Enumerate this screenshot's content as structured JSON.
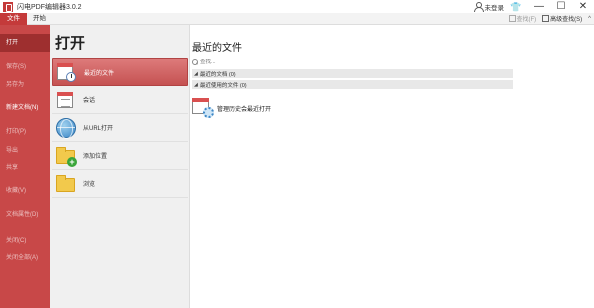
{
  "app": {
    "title": "闪电PDF编辑器3.0.2"
  },
  "titlebar": {
    "login_label": "未登录",
    "icons": [
      "user-icon",
      "shirt-icon",
      "minimize-icon",
      "maximize-icon",
      "close-icon"
    ]
  },
  "ribbon": {
    "tabs": [
      {
        "label": "文件",
        "active": true
      },
      {
        "label": "开始",
        "active": false
      }
    ],
    "find_label": "查找(F)",
    "advanced_find_label": "高级查找(S)",
    "collapse_glyph": "^"
  },
  "nav": {
    "items": [
      {
        "label": "打开",
        "state": "active"
      },
      {
        "label": "保存(S)",
        "state": "disabled"
      },
      {
        "label": "另存为",
        "state": "disabled"
      },
      {
        "label": "新建文档(N)",
        "state": "enabled"
      },
      {
        "label": "打印(P)",
        "state": "disabled"
      },
      {
        "label": "导出",
        "state": "disabled"
      },
      {
        "label": "共享",
        "state": "disabled"
      },
      {
        "label": "收藏(V)",
        "state": "disabled"
      },
      {
        "label": "文档属性(D)",
        "state": "disabled"
      },
      {
        "label": "关闭(C)",
        "state": "disabled"
      },
      {
        "label": "关闭全部(A)",
        "state": "disabled"
      }
    ]
  },
  "open": {
    "heading": "打开",
    "items": [
      {
        "label": "最近的文件",
        "icon": "recent-files-icon",
        "active": true
      },
      {
        "label": "会话",
        "icon": "session-icon",
        "active": false
      },
      {
        "label": "从URL打开",
        "icon": "globe-icon",
        "active": false
      },
      {
        "label": "添加位置",
        "icon": "add-folder-icon",
        "active": false
      },
      {
        "label": "浏览",
        "icon": "folder-icon",
        "active": false
      }
    ]
  },
  "recent": {
    "title": "最近的文件",
    "search_placeholder": "查找...",
    "groups": [
      {
        "label": "最近的文档 (0)"
      },
      {
        "label": "最近使用的文件 (0)"
      }
    ],
    "manage_label": "管理历史会最近打开"
  },
  "colors": {
    "accent": "#c84848",
    "nav_active": "#9e2f2f",
    "selected_item": "#d46464"
  }
}
